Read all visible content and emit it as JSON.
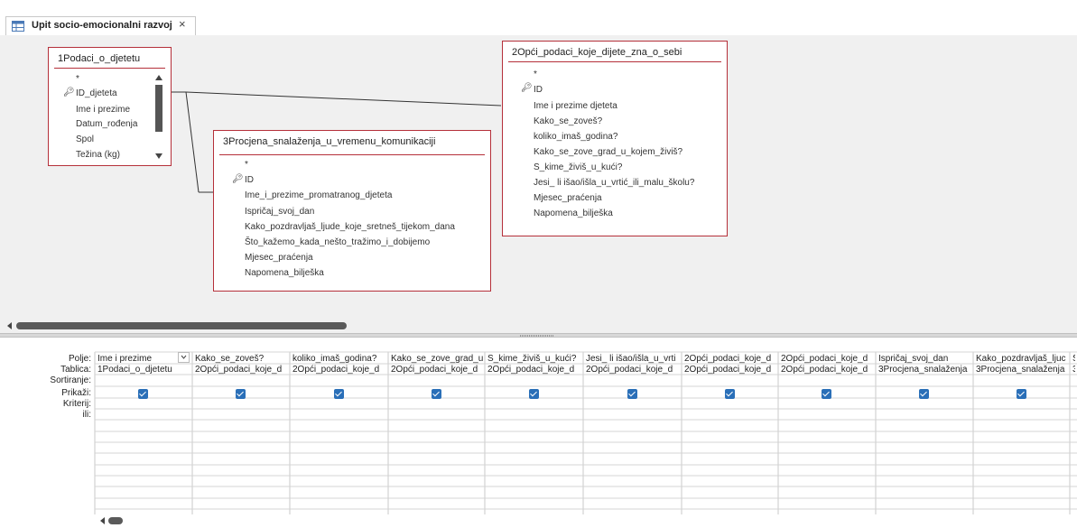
{
  "tab": {
    "title": "Upit socio-emocionalni razvoj",
    "close": "×"
  },
  "tables": {
    "t1": {
      "title": "1Podaci_o_djetetu",
      "fields": [
        "*",
        "ID_djeteta",
        "Ime i prezime",
        "Datum_rođenja",
        "Spol",
        "Težina (kg)"
      ],
      "key_index": 1
    },
    "t2": {
      "title": "2Opći_podaci_koje_dijete_zna_o_sebi",
      "fields": [
        "*",
        "ID",
        "Ime i prezime djeteta",
        "Kako_se_zoveš?",
        "koliko_imaš_godina?",
        "Kako_se_zove_grad_u_kojem_živiš?",
        "S_kime_živiš_u_kući?",
        "Jesi_ li išao/išla_u_vrtić_ili_malu_školu?",
        "Mjesec_praćenja",
        "Napomena_bilješka"
      ],
      "key_index": 1
    },
    "t3": {
      "title": "3Procjena_snalaženja_u_vremenu_komunikaciji",
      "fields": [
        "*",
        "ID",
        "Ime_i_prezime_promatranog_djeteta",
        "Ispričaj_svoj_dan",
        "Kako_pozdravljaš_ljude_koje_sretneš_tijekom_dana",
        "Što_kažemo_kada_nešto_tražimo_i_dobijemo",
        "Mjesec_praćenja",
        "Napomena_bilješka"
      ],
      "key_index": 1
    }
  },
  "grid": {
    "row_labels": [
      "Polje:",
      "Tablica:",
      "Sortiranje:",
      "Prikaži:",
      "Kriterij:",
      "ili:"
    ],
    "columns": [
      {
        "field": "Ime i prezime",
        "table": "1Podaci_o_djetetu",
        "show": true
      },
      {
        "field": "Kako_se_zoveš?",
        "table": "2Opći_podaci_koje_d",
        "show": true
      },
      {
        "field": "koliko_imaš_godina?",
        "table": "2Opći_podaci_koje_d",
        "show": true
      },
      {
        "field": "Kako_se_zove_grad_u",
        "table": "2Opći_podaci_koje_d",
        "show": true
      },
      {
        "field": "S_kime_živiš_u_kući?",
        "table": "2Opći_podaci_koje_d",
        "show": true
      },
      {
        "field": "Jesi_ li išao/išla_u_vrti",
        "table": "2Opći_podaci_koje_d",
        "show": true
      },
      {
        "field": "2Opći_podaci_koje_d",
        "table": "2Opći_podaci_koje_d",
        "show": true
      },
      {
        "field": "2Opći_podaci_koje_d",
        "table": "2Opći_podaci_koje_d",
        "show": true
      },
      {
        "field": "Ispričaj_svoj_dan",
        "table": "3Procjena_snalaženja",
        "show": true
      },
      {
        "field": "Kako_pozdravljaš_ljuc",
        "table": "3Procjena_snalaženja",
        "show": true
      },
      {
        "field": "Š",
        "table": "3",
        "show": false
      }
    ]
  },
  "colors": {
    "table_border": "#b5303a",
    "check": "#2a6fb8",
    "panel_bg": "#f0f0f0"
  }
}
